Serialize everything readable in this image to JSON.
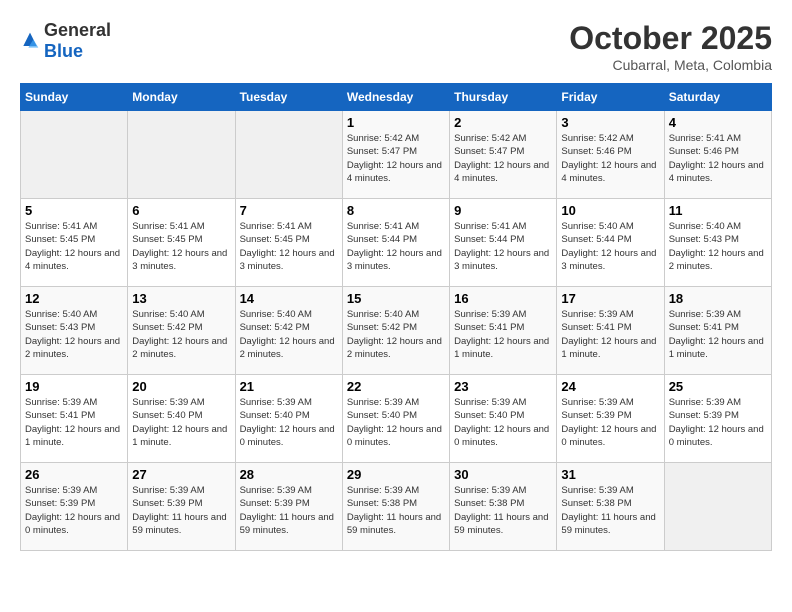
{
  "header": {
    "logo_general": "General",
    "logo_blue": "Blue",
    "month": "October 2025",
    "location": "Cubarral, Meta, Colombia"
  },
  "days_of_week": [
    "Sunday",
    "Monday",
    "Tuesday",
    "Wednesday",
    "Thursday",
    "Friday",
    "Saturday"
  ],
  "weeks": [
    [
      {
        "day": "",
        "info": ""
      },
      {
        "day": "",
        "info": ""
      },
      {
        "day": "",
        "info": ""
      },
      {
        "day": "1",
        "info": "Sunrise: 5:42 AM\nSunset: 5:47 PM\nDaylight: 12 hours\nand 4 minutes."
      },
      {
        "day": "2",
        "info": "Sunrise: 5:42 AM\nSunset: 5:47 PM\nDaylight: 12 hours\nand 4 minutes."
      },
      {
        "day": "3",
        "info": "Sunrise: 5:42 AM\nSunset: 5:46 PM\nDaylight: 12 hours\nand 4 minutes."
      },
      {
        "day": "4",
        "info": "Sunrise: 5:41 AM\nSunset: 5:46 PM\nDaylight: 12 hours\nand 4 minutes."
      }
    ],
    [
      {
        "day": "5",
        "info": "Sunrise: 5:41 AM\nSunset: 5:45 PM\nDaylight: 12 hours\nand 4 minutes."
      },
      {
        "day": "6",
        "info": "Sunrise: 5:41 AM\nSunset: 5:45 PM\nDaylight: 12 hours\nand 3 minutes."
      },
      {
        "day": "7",
        "info": "Sunrise: 5:41 AM\nSunset: 5:45 PM\nDaylight: 12 hours\nand 3 minutes."
      },
      {
        "day": "8",
        "info": "Sunrise: 5:41 AM\nSunset: 5:44 PM\nDaylight: 12 hours\nand 3 minutes."
      },
      {
        "day": "9",
        "info": "Sunrise: 5:41 AM\nSunset: 5:44 PM\nDaylight: 12 hours\nand 3 minutes."
      },
      {
        "day": "10",
        "info": "Sunrise: 5:40 AM\nSunset: 5:44 PM\nDaylight: 12 hours\nand 3 minutes."
      },
      {
        "day": "11",
        "info": "Sunrise: 5:40 AM\nSunset: 5:43 PM\nDaylight: 12 hours\nand 2 minutes."
      }
    ],
    [
      {
        "day": "12",
        "info": "Sunrise: 5:40 AM\nSunset: 5:43 PM\nDaylight: 12 hours\nand 2 minutes."
      },
      {
        "day": "13",
        "info": "Sunrise: 5:40 AM\nSunset: 5:42 PM\nDaylight: 12 hours\nand 2 minutes."
      },
      {
        "day": "14",
        "info": "Sunrise: 5:40 AM\nSunset: 5:42 PM\nDaylight: 12 hours\nand 2 minutes."
      },
      {
        "day": "15",
        "info": "Sunrise: 5:40 AM\nSunset: 5:42 PM\nDaylight: 12 hours\nand 2 minutes."
      },
      {
        "day": "16",
        "info": "Sunrise: 5:39 AM\nSunset: 5:41 PM\nDaylight: 12 hours\nand 1 minute."
      },
      {
        "day": "17",
        "info": "Sunrise: 5:39 AM\nSunset: 5:41 PM\nDaylight: 12 hours\nand 1 minute."
      },
      {
        "day": "18",
        "info": "Sunrise: 5:39 AM\nSunset: 5:41 PM\nDaylight: 12 hours\nand 1 minute."
      }
    ],
    [
      {
        "day": "19",
        "info": "Sunrise: 5:39 AM\nSunset: 5:41 PM\nDaylight: 12 hours\nand 1 minute."
      },
      {
        "day": "20",
        "info": "Sunrise: 5:39 AM\nSunset: 5:40 PM\nDaylight: 12 hours\nand 1 minute."
      },
      {
        "day": "21",
        "info": "Sunrise: 5:39 AM\nSunset: 5:40 PM\nDaylight: 12 hours\nand 0 minutes."
      },
      {
        "day": "22",
        "info": "Sunrise: 5:39 AM\nSunset: 5:40 PM\nDaylight: 12 hours\nand 0 minutes."
      },
      {
        "day": "23",
        "info": "Sunrise: 5:39 AM\nSunset: 5:40 PM\nDaylight: 12 hours\nand 0 minutes."
      },
      {
        "day": "24",
        "info": "Sunrise: 5:39 AM\nSunset: 5:39 PM\nDaylight: 12 hours\nand 0 minutes."
      },
      {
        "day": "25",
        "info": "Sunrise: 5:39 AM\nSunset: 5:39 PM\nDaylight: 12 hours\nand 0 minutes."
      }
    ],
    [
      {
        "day": "26",
        "info": "Sunrise: 5:39 AM\nSunset: 5:39 PM\nDaylight: 12 hours\nand 0 minutes."
      },
      {
        "day": "27",
        "info": "Sunrise: 5:39 AM\nSunset: 5:39 PM\nDaylight: 11 hours\nand 59 minutes."
      },
      {
        "day": "28",
        "info": "Sunrise: 5:39 AM\nSunset: 5:39 PM\nDaylight: 11 hours\nand 59 minutes."
      },
      {
        "day": "29",
        "info": "Sunrise: 5:39 AM\nSunset: 5:38 PM\nDaylight: 11 hours\nand 59 minutes."
      },
      {
        "day": "30",
        "info": "Sunrise: 5:39 AM\nSunset: 5:38 PM\nDaylight: 11 hours\nand 59 minutes."
      },
      {
        "day": "31",
        "info": "Sunrise: 5:39 AM\nSunset: 5:38 PM\nDaylight: 11 hours\nand 59 minutes."
      },
      {
        "day": "",
        "info": ""
      }
    ]
  ]
}
